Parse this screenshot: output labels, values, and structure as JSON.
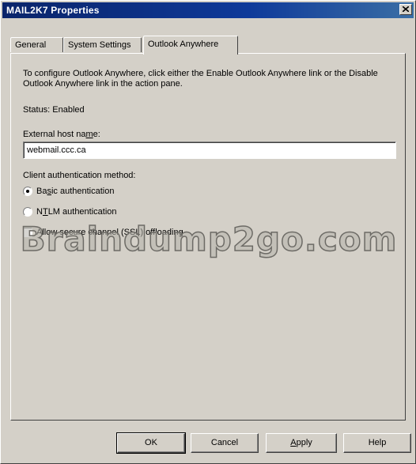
{
  "window": {
    "title": "MAIL2K7 Properties"
  },
  "tabs": [
    {
      "label": "General",
      "active": false
    },
    {
      "label": "System Settings",
      "active": false
    },
    {
      "label": "Outlook Anywhere",
      "active": true
    }
  ],
  "panel": {
    "description": "To configure Outlook Anywhere, click either the Enable Outlook Anywhere link or the Disable Outlook Anywhere link in the action pane.",
    "status_text": "Status:  Enabled",
    "host_label": "External host name:",
    "host_value": "webmail.ccc.ca",
    "auth_label": "Client authentication method:",
    "auth_options": [
      {
        "label": "Basic authentication",
        "selected": true
      },
      {
        "label": "NTLM authentication",
        "selected": false
      },
      {
        "label": "Allow secure channel (SSL) offloading",
        "selected": false
      }
    ]
  },
  "watermark": "Braindump2go.com",
  "buttons": {
    "ok": "OK",
    "cancel": "Cancel",
    "apply": "Apply",
    "help": "Help"
  }
}
